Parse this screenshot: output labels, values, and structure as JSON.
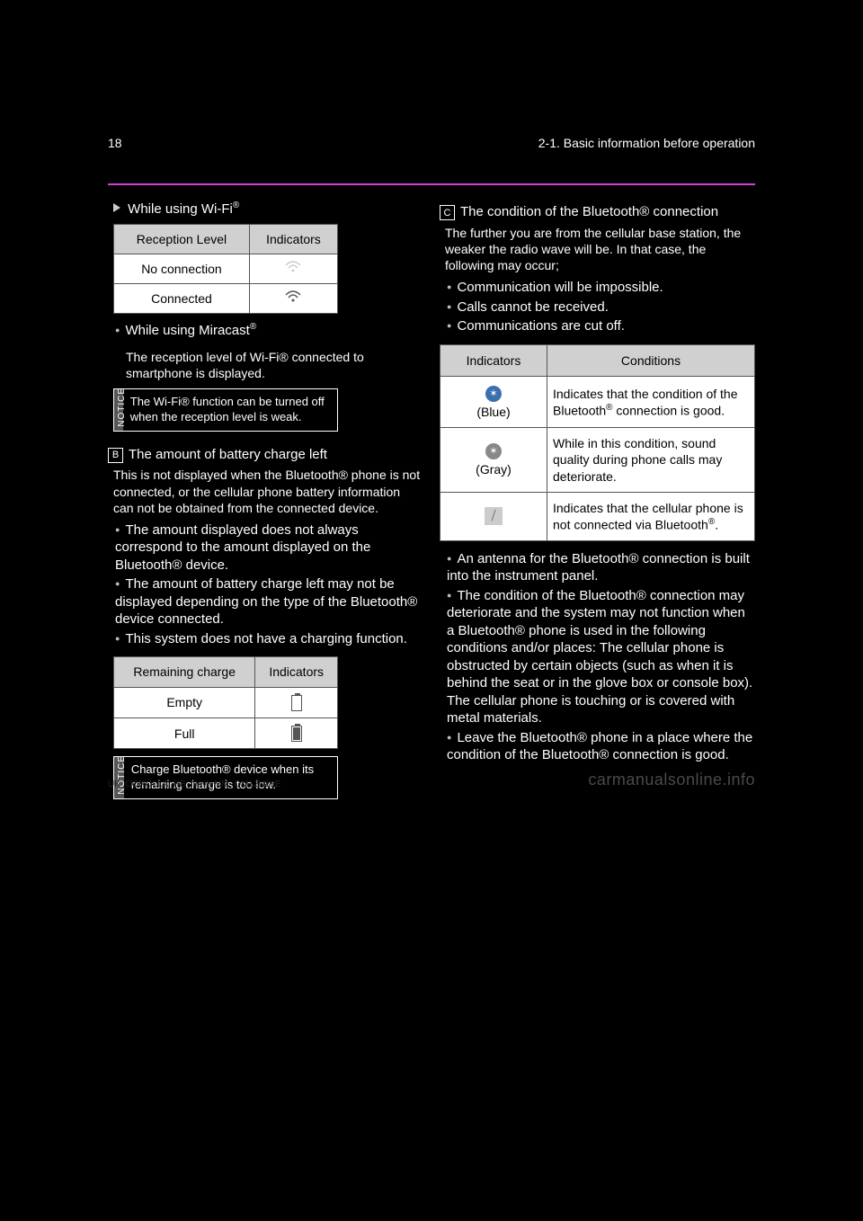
{
  "header": {
    "pageno": "18",
    "chapter_no": "2-1.",
    "chapter_title": "Basic information before operation"
  },
  "left": {
    "wifi_heading": "While using Wi-Fi",
    "wifi_sup": "®",
    "table_wifi": {
      "col1": "Reception Level",
      "col2": "Indicators",
      "rows": [
        {
          "label": "No  connection",
          "icon": "wifi-faint"
        },
        {
          "label": "Connected",
          "icon": "wifi"
        }
      ]
    },
    "miracast_bullet": "While using Miracast",
    "miracast_sup": "®",
    "miracast_note": "The reception level of Wi-Fi® connected to smartphone is displayed.",
    "notice1_label": "NOTICE",
    "notice1_body": "The Wi-Fi® function can be turned off when the reception level is weak.",
    "section_b_num": "B",
    "section_b_txt_pre": "The amount of battery charge left",
    "section_b_body": "This is not displayed when the Bluetooth® phone is not connected, or the cellular phone battery information can not be obtained from the connected device.",
    "section_b_bullets": [
      "The amount displayed does not always correspond to the amount displayed on the Bluetooth® device.",
      "The amount of battery charge left may not be displayed depending on the type of the Bluetooth® device connected.",
      "This system does not have a charging function."
    ],
    "table_batt": {
      "col1": "Remaining charge",
      "col2": "Indicators",
      "rows": [
        {
          "label": "Empty",
          "icon": "empty"
        },
        {
          "label": "Full",
          "icon": "full"
        }
      ]
    },
    "notice2_label": "NOTICE",
    "notice2_body": "Charge Bluetooth® device when its remaining charge is too low."
  },
  "right": {
    "section_c_num": "C",
    "section_c_head": "The condition of the Bluetooth® connection",
    "intro": "The further you are from the cellular base station, the weaker the radio wave will be. In that case, the following may occur;",
    "intro_bullets": [
      "Communication will be impossible.",
      "Calls cannot be received.",
      "Communications are cut off."
    ],
    "table_cond": {
      "col1": "Indicators",
      "col2": "Conditions",
      "rows": [
        {
          "icon": "bt-blue",
          "icon_label": "(Blue)",
          "desc_pre": "Indicates that the condition of the ",
          "desc_bt": "Bluetooth",
          "desc_post": " connection is good."
        },
        {
          "icon": "bt-gray",
          "icon_label": "(Gray)",
          "desc_full": "While in this condition, sound quality during phone calls may deteriorate."
        },
        {
          "icon": "nophone",
          "icon_label": "",
          "desc_pre": "Indicates that the cellular phone is not connected via ",
          "desc_bt": "Bluetooth",
          "desc_post": "."
        }
      ]
    },
    "tail_bullets": [
      "An antenna for the Bluetooth® connection is built into the instrument panel.",
      "The condition of the Bluetooth® connection may deteriorate and the system may not function when a Bluetooth® phone is used in the following conditions and/or places: The cellular phone is obstructed by certain objects (such as when it is behind the seat or in the glove box or console box). The cellular phone is touching or is covered with metal materials.",
      "Leave the Bluetooth® phone in a place where the condition of the Bluetooth® connection is good."
    ]
  },
  "footer": {
    "watermark": "carmanualsonline.info",
    "code": "UK_COROLLA_HB_Navi+MM_OM12N88E"
  }
}
